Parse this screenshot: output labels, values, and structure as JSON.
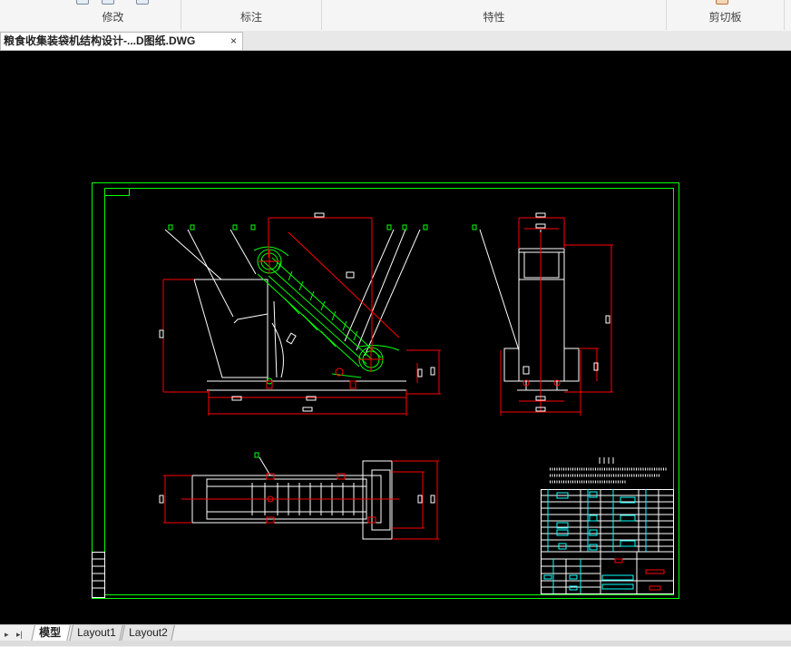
{
  "ribbon": {
    "groups": [
      {
        "label": "修改"
      },
      {
        "label": "标注"
      },
      {
        "label": "特性"
      },
      {
        "label": "剪切板"
      }
    ]
  },
  "document_tab": {
    "title": "粮食收集装袋机结构设计-...D图纸.DWG",
    "close_symbol": "×"
  },
  "layout_tabs": [
    {
      "label": "模型",
      "active": true
    },
    {
      "label": "Layout1",
      "active": false
    },
    {
      "label": "Layout2",
      "active": false
    }
  ],
  "nav": {
    "prev_symbol": "▸",
    "last_symbol": "▸|"
  },
  "colors": {
    "canvas_background": "#000000",
    "frame_green": "#00ff00",
    "dimension_red": "#ff0000",
    "geometry_white": "#ffffff",
    "table_cyan": "#00ffff"
  }
}
